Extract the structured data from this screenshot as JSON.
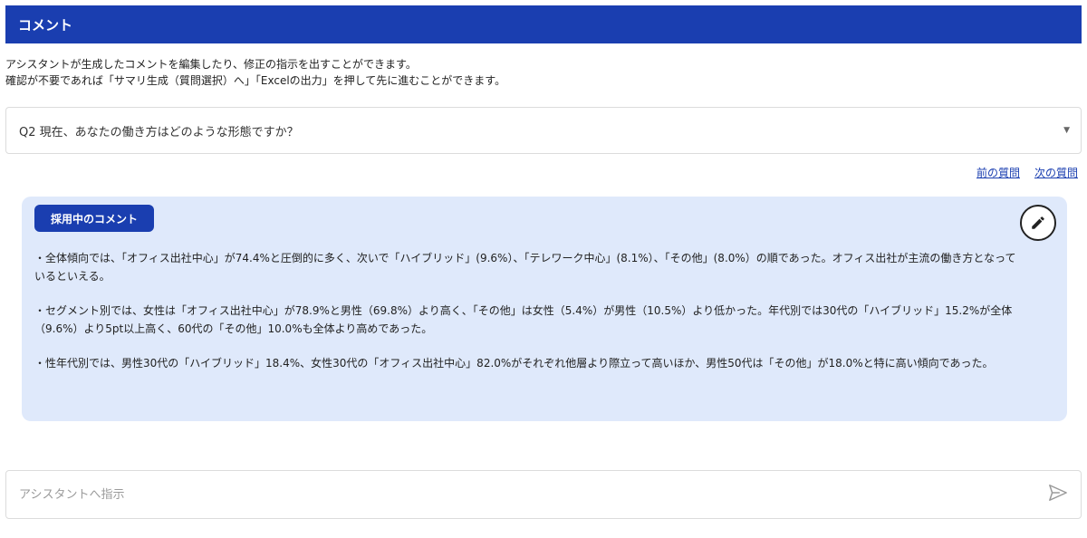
{
  "header": {
    "title": "コメント"
  },
  "description": {
    "line1": "アシスタントが生成したコメントを編集したり、修正の指示を出すことができます。",
    "line2": "確認が不要であれば「サマリ生成（質問選択）へ」「Excelの出力」を押して先に進むことができます。"
  },
  "question_select": {
    "selected": "Q2 現在、あなたの働き方はどのような形態ですか？",
    "icon": "chevron-down-icon"
  },
  "nav": {
    "prev_label": "前の質問",
    "next_label": "次の質問"
  },
  "comment": {
    "badge": "採用中のコメント",
    "edit_icon": "pencil-icon",
    "paragraphs": [
      "・全体傾向では、「オフィス出社中心」が74.4%と圧倒的に多く、次いで「ハイブリッド」(9.6%）、「テレワーク中心」(8.1%）、「その他」(8.0%）の順であった。オフィス出社が主流の働き方となっているといえる。",
      "・セグメント別では、女性は「オフィス出社中心」が78.9%と男性（69.8%）より高く、「その他」は女性（5.4%）が男性（10.5%）より低かった。年代別では30代の「ハイブリッド」15.2%が全体（9.6%）より5pt以上高く、60代の「その他」10.0%も全体より高めであった。",
      "・性年代別では、男性30代の「ハイブリッド」18.4%、女性30代の「オフィス出社中心」82.0%がそれぞれ他層より際立って高いほか、男性50代は「その他」が18.0%と特に高い傾向であった。"
    ]
  },
  "instruction": {
    "placeholder": "アシスタントへ指示",
    "send_icon": "send-icon"
  },
  "colors": {
    "primary": "#1a3eb0",
    "card_bg": "#dfe9fb"
  }
}
